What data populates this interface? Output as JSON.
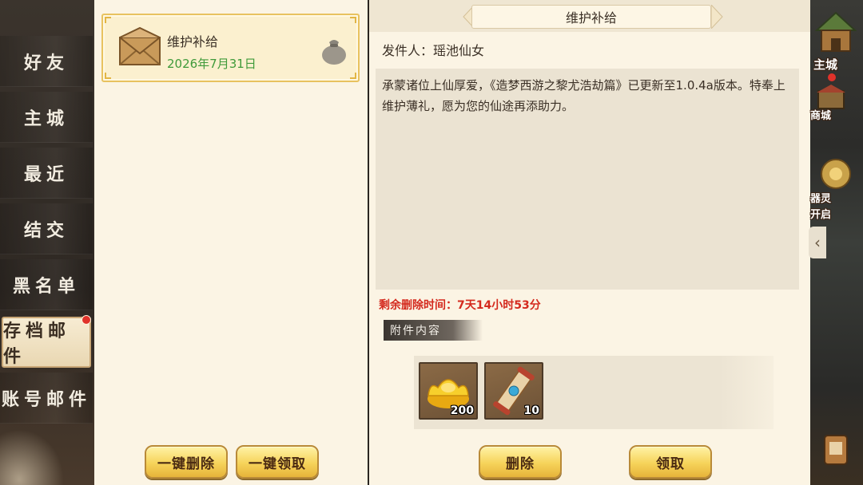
{
  "sidebar": {
    "tabs": [
      {
        "label": "好友"
      },
      {
        "label": "主城"
      },
      {
        "label": "最近"
      },
      {
        "label": "结交"
      },
      {
        "label": "黑名单"
      },
      {
        "label": "存档邮件",
        "active": true,
        "badge": "red-dot"
      },
      {
        "label": "账号邮件"
      }
    ]
  },
  "mail_list": {
    "items": [
      {
        "title": "维护补给",
        "date": "2026年7月31日",
        "icon": "envelope-icon",
        "attachment_icon": "money-bag-icon"
      }
    ],
    "delete_all_label": "一键删除",
    "claim_all_label": "一键领取"
  },
  "detail": {
    "title": "维护补给",
    "sender": "发件人：瑶池仙女",
    "body": "承蒙诸位上仙厚爱，《造梦西游之黎尤浩劫篇》已更新至1.0.4a版本。特奉上维护薄礼，愿为您的仙途再添助力。",
    "remaining_time": "剩余删除时间：7天14小时53分",
    "attachment_label": "附件内容",
    "attachments": [
      {
        "icon": "gold-ingot-icon",
        "qty": "200"
      },
      {
        "icon": "scroll-icon",
        "qty": "10"
      }
    ],
    "delete_label": "删除",
    "claim_label": "领取"
  },
  "game_edge": {
    "labels": [
      "主城",
      "商城",
      "器灵",
      "开启"
    ]
  },
  "colors": {
    "accent_gold": "#f6d35a",
    "date_green": "#3f9a3a",
    "warning_red": "#d42a1e",
    "panel_bg": "#fbf4e4"
  }
}
